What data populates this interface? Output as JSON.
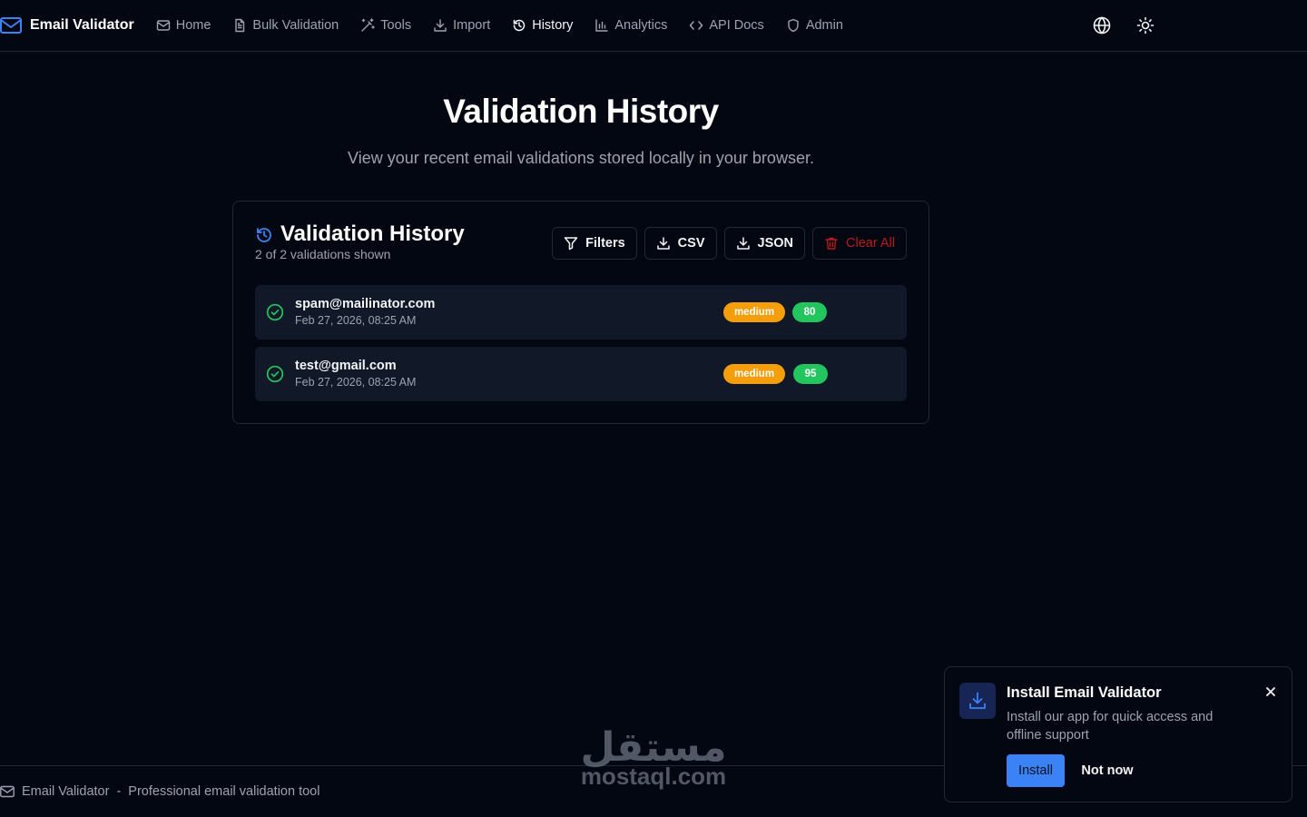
{
  "header": {
    "brand": "Email Validator",
    "nav": [
      {
        "label": "Home",
        "icon": "mail-icon"
      },
      {
        "label": "Bulk Validation",
        "icon": "file-text-icon"
      },
      {
        "label": "Tools",
        "icon": "wand-icon"
      },
      {
        "label": "Import",
        "icon": "download-icon"
      },
      {
        "label": "History",
        "icon": "history-icon",
        "active": true
      },
      {
        "label": "Analytics",
        "icon": "bar-chart-icon"
      },
      {
        "label": "API Docs",
        "icon": "code-icon"
      },
      {
        "label": "Admin",
        "icon": "shield-icon"
      }
    ],
    "right_icons": [
      "globe-icon",
      "sun-icon"
    ]
  },
  "hero": {
    "title": "Validation History",
    "subtitle": "View your recent email validations stored locally in your browser."
  },
  "card": {
    "title": "Validation History",
    "count_text": "2 of 2 validations shown",
    "actions": {
      "filters": "Filters",
      "csv": "CSV",
      "json": "JSON",
      "clear": "Clear All"
    },
    "rows": [
      {
        "email": "spam@mailinator.com",
        "date": "Feb 27, 2026, 08:25 AM",
        "risk": "medium",
        "score": "80"
      },
      {
        "email": "test@gmail.com",
        "date": "Feb 27, 2026, 08:25 AM",
        "risk": "medium",
        "score": "95"
      }
    ]
  },
  "footer": {
    "brand": "Email Validator",
    "separator": "-",
    "tagline": "Professional email validation tool"
  },
  "watermark": {
    "arabic": "مستقل",
    "latin": "mostaql.com"
  },
  "toast": {
    "title": "Install Email Validator",
    "body": "Install our app for quick access and offline support",
    "install": "Install",
    "dismiss": "Not now"
  },
  "colors": {
    "background": "#030712",
    "accent": "#3b82f6",
    "risk_medium": "#f59e0b",
    "score_good": "#22c55e",
    "danger": "#b91c1c"
  }
}
